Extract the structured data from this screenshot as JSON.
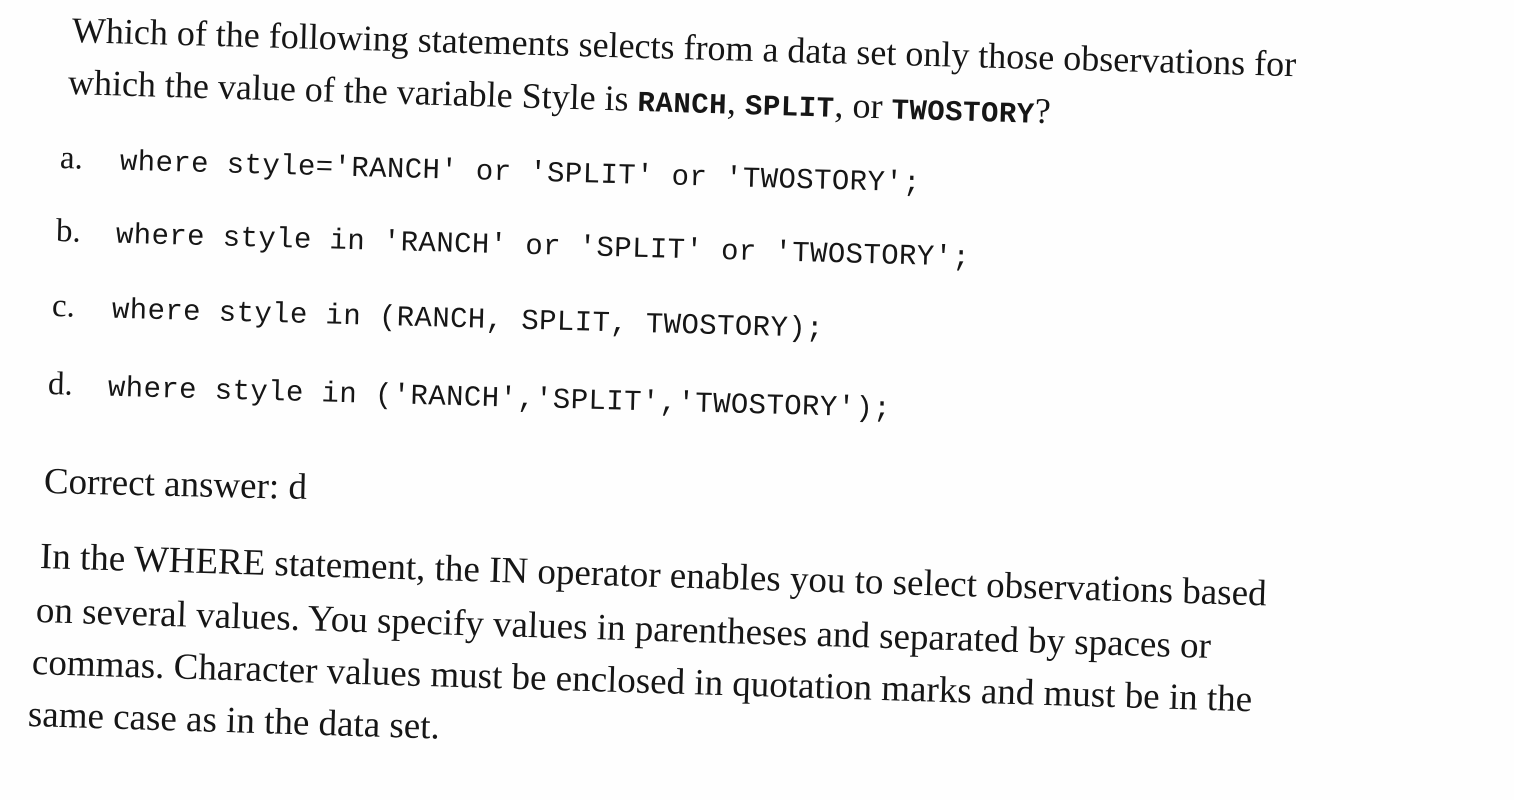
{
  "question": {
    "line1": "Which of the following statements selects from a data set only those observations for",
    "line2_prefix": "which the value of the variable Style is ",
    "value1": "RANCH",
    "sep1": ", ",
    "value2": "SPLIT",
    "sep2": ", or ",
    "value3": "TWOSTORY",
    "end": "?"
  },
  "options": [
    {
      "letter": "a.",
      "code": "where style='RANCH' or 'SPLIT' or 'TWOSTORY';"
    },
    {
      "letter": "b.",
      "code": "where style in 'RANCH' or 'SPLIT' or 'TWOSTORY';"
    },
    {
      "letter": "c.",
      "code": "where style in (RANCH, SPLIT, TWOSTORY);"
    },
    {
      "letter": "d.",
      "code": "where style in ('RANCH','SPLIT','TWOSTORY');"
    }
  ],
  "answer": "Correct answer: d",
  "explanation": {
    "line1": "In the WHERE statement, the IN operator enables you to select observations based",
    "line2": "on several values. You specify values in parentheses and separated by spaces or",
    "line3": "commas. Character values must be enclosed in quotation marks and must be in the",
    "line4": "same case as in the data set."
  }
}
